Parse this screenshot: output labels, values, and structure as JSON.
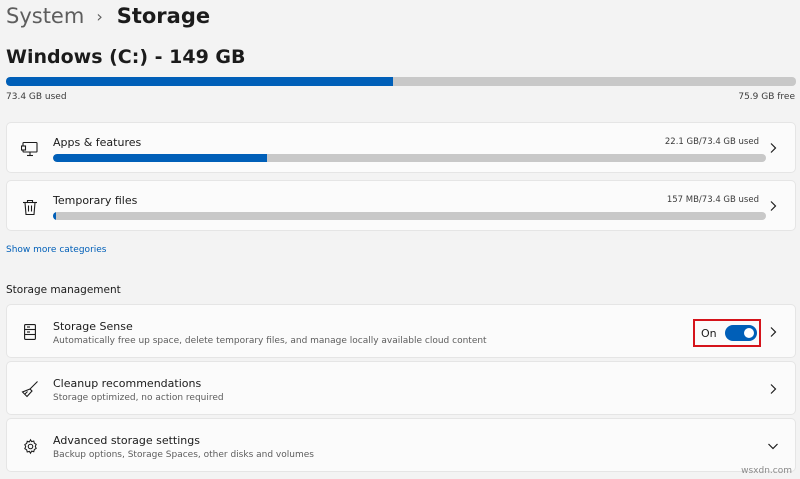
{
  "breadcrumb": {
    "parent": "System",
    "separator": "›",
    "current": "Storage"
  },
  "drive": {
    "title": "Windows (C:) - 149 GB",
    "used_label": "73.4 GB used",
    "free_label": "75.9 GB free",
    "used_fraction": 0.49,
    "accent_color": "#005fb8"
  },
  "categories": [
    {
      "title": "Apps & features",
      "size": "22.1 GB/73.4 GB used",
      "fraction": 0.3,
      "icon": "apps-monitor-icon"
    },
    {
      "title": "Temporary files",
      "size": "157 MB/73.4 GB used",
      "fraction": 0.003,
      "icon": "trash-icon"
    }
  ],
  "show_more_label": "Show more categories",
  "storage_management": {
    "header": "Storage management",
    "items": [
      {
        "title": "Storage Sense",
        "desc": "Automatically free up space, delete temporary files, and manage locally available cloud content",
        "toggle_label": "On",
        "toggle_on": true,
        "icon": "drive-icon",
        "highlight_color": "#d5141b"
      },
      {
        "title": "Cleanup recommendations",
        "desc": "Storage optimized, no action required",
        "icon": "broom-icon"
      },
      {
        "title": "Advanced storage settings",
        "desc": "Backup options, Storage Spaces, other disks and volumes",
        "icon": "gear-icon"
      }
    ]
  },
  "watermark": "wsxdn.com"
}
